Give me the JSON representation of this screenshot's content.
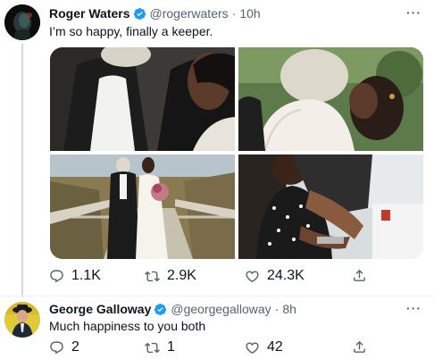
{
  "tweet1": {
    "name": "Roger Waters",
    "handle": "@rogerwaters",
    "separator": "·",
    "time": "10h",
    "text": "I’m so happy, finally a keeper.",
    "replies": "1.1K",
    "retweets": "2.9K",
    "likes": "24.3K",
    "photos": [
      "couple-suit-and-dress",
      "embrace-lace-dress",
      "couple-on-dock-with-bouquet",
      "couple-cooking-kitchen"
    ]
  },
  "tweet2": {
    "name": "George Galloway",
    "handle": "@georgegalloway",
    "separator": "·",
    "time": "8h",
    "text": "Much happiness to you both",
    "replies": "2",
    "retweets": "1",
    "likes": "42"
  },
  "icons": {
    "verified": "verified-badge-icon",
    "more": "more-dots-icon",
    "reply": "reply-icon",
    "retweet": "retweet-icon",
    "like": "heart-icon",
    "share": "share-icon"
  },
  "colors": {
    "verified": "#1d9bf0",
    "secondary_text": "#536471",
    "primary_text": "#0f1419"
  }
}
